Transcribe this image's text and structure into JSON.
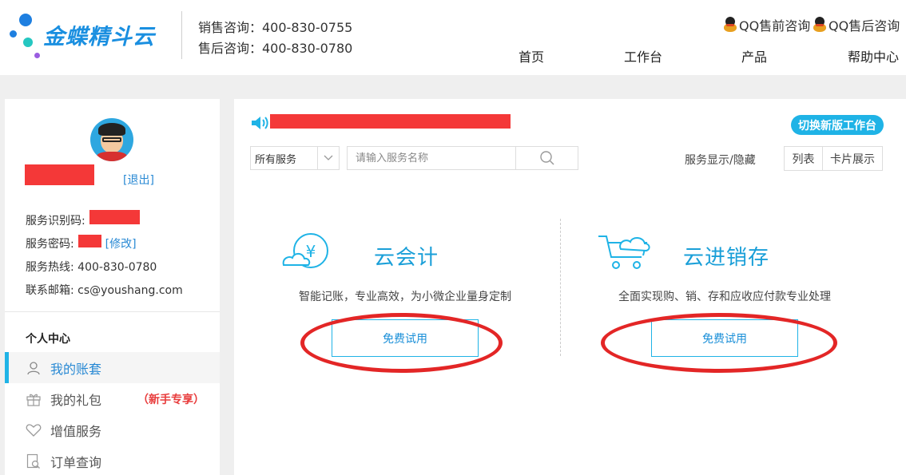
{
  "header": {
    "logo_text": "金蝶精斗云",
    "sales_contact": "销售咨询：400-830-0755",
    "support_contact": "售后咨询：400-830-0780",
    "qq_presales": "QQ售前咨询",
    "qq_aftersales": "QQ售后咨询",
    "nav": [
      "首页",
      "工作台",
      "产品",
      "帮助中心"
    ],
    "brand_color": "#1a8fe0"
  },
  "sidebar": {
    "logout": "[退出]",
    "service_id_label": "服务识别码:",
    "service_pwd_label": "服务密码:",
    "modify_link": "[修改]",
    "hotline": "服务热线: 400-830-0780",
    "email": "联系邮箱: cs@youshang.com",
    "section_title": "个人中心",
    "menu": [
      {
        "label": "我的账套",
        "icon": "user-icon",
        "active": true
      },
      {
        "label": "我的礼包",
        "icon": "gift-icon",
        "tag": "（新手专享）"
      },
      {
        "label": "增值服务",
        "icon": "heart-icon"
      },
      {
        "label": "订单查询",
        "icon": "order-search-icon"
      }
    ]
  },
  "main": {
    "switch_button": "切换新版工作台",
    "service_select": "所有服务",
    "search_placeholder": "请输入服务名称",
    "toggle_label": "服务显示/隐藏",
    "view_list": "列表",
    "view_card": "卡片展示",
    "cards": [
      {
        "title": "云会计",
        "desc": "智能记账，专业高效，为小微企业量身定制",
        "button": "免费试用",
        "icon": "cloud-yen-icon"
      },
      {
        "title": "云进销存",
        "desc": "全面实现购、销、存和应收应付款专业处理",
        "button": "免费试用",
        "icon": "cloud-cart-icon"
      }
    ],
    "accent_color": "#1fb3e6",
    "highlight_color": "#e32626"
  }
}
